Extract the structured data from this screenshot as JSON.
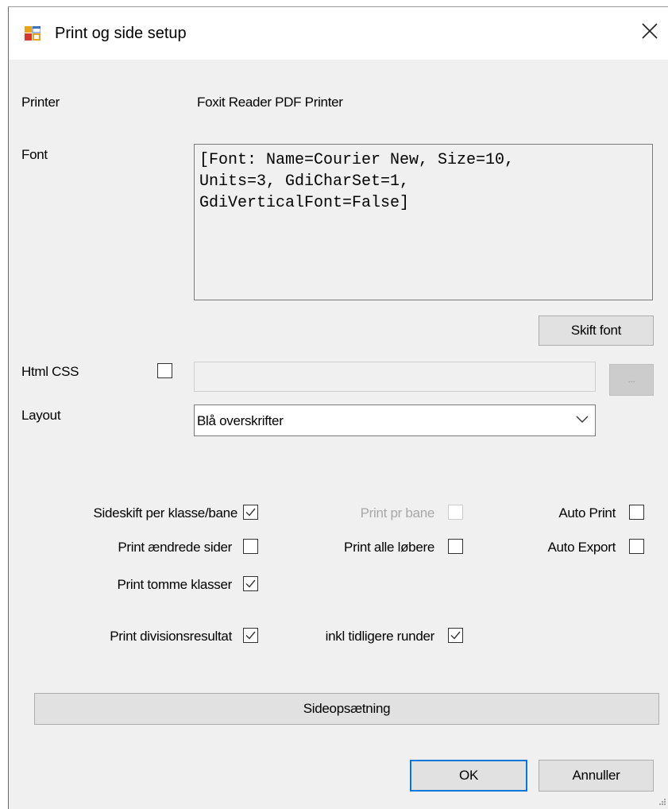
{
  "window": {
    "title": "Print og side setup"
  },
  "printer": {
    "label": "Printer",
    "value": "Foxit Reader PDF Printer"
  },
  "font": {
    "label": "Font",
    "value": "[Font: Name=Courier New, Size=10,\nUnits=3, GdiCharSet=1,\nGdiVerticalFont=False]",
    "change_button": "Skift font"
  },
  "html_css": {
    "label": "Html CSS",
    "checked": false,
    "path": "",
    "browse_button": "..."
  },
  "layout": {
    "label": "Layout",
    "selected": "Blå overskrifter"
  },
  "options": {
    "sideskift": {
      "label": "Sideskift per klasse/bane",
      "checked": true
    },
    "print_pr_bane": {
      "label": "Print pr bane",
      "checked": false,
      "disabled": true
    },
    "auto_print": {
      "label": "Auto Print",
      "checked": false
    },
    "print_aendrede": {
      "label": "Print ændrede sider",
      "checked": false
    },
    "print_alle": {
      "label": "Print alle løbere",
      "checked": false
    },
    "auto_export": {
      "label": "Auto Export",
      "checked": false
    },
    "print_tomme": {
      "label": "Print tomme klasser",
      "checked": true
    },
    "print_division": {
      "label": "Print divisionsresultat",
      "checked": true
    },
    "inkl_tidligere": {
      "label": "inkl tidligere runder",
      "checked": true
    }
  },
  "page_setup_button": "Sideopsætning",
  "ok_button": "OK",
  "cancel_button": "Annuller",
  "colors": {
    "accent": "#0078d7",
    "dialog_bg": "#f0f0f0",
    "title_bg": "#ffffff"
  }
}
